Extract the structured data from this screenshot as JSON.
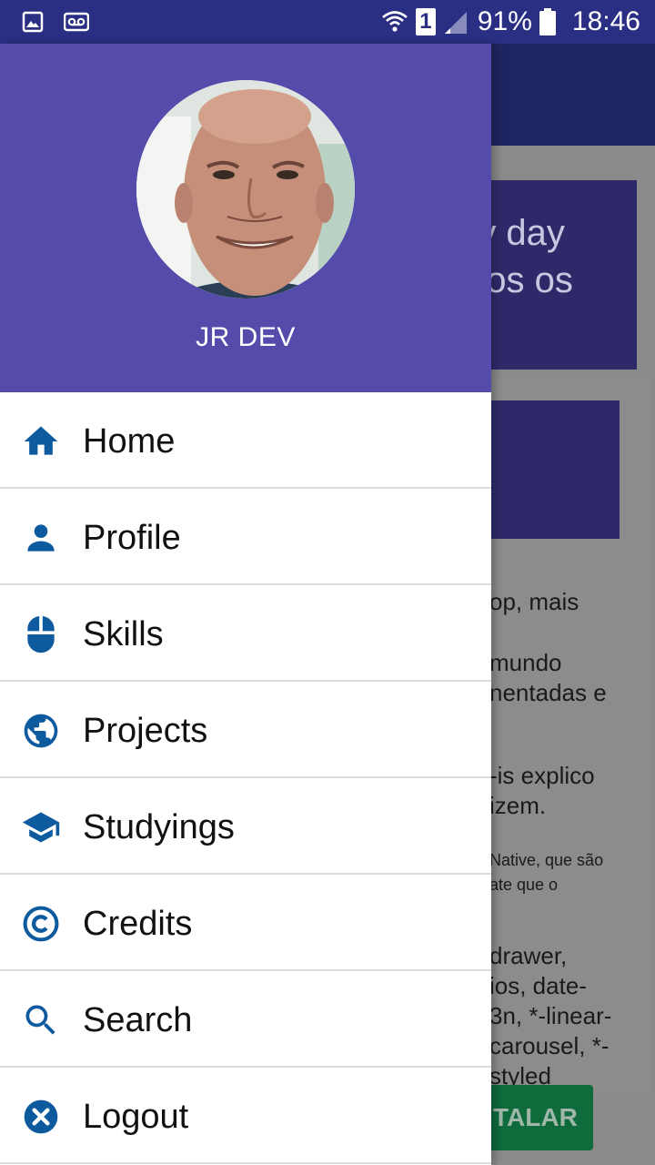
{
  "status_bar": {
    "icons_left": [
      "image-icon",
      "voicemail-icon"
    ],
    "icons_right": [
      "wifi-icon",
      "sim-icon",
      "signal-icon",
      "battery-icon"
    ],
    "sim_number": "1",
    "battery": "91%",
    "time": "18:46"
  },
  "drawer": {
    "user_name": "JR DEV",
    "items": [
      {
        "label": "Home",
        "icon": "home-icon"
      },
      {
        "label": "Profile",
        "icon": "person-icon"
      },
      {
        "label": "Skills",
        "icon": "mouse-icon"
      },
      {
        "label": "Projects",
        "icon": "globe-icon"
      },
      {
        "label": "Studyings",
        "icon": "graduation-cap-icon"
      },
      {
        "label": "Credits",
        "icon": "copyright-icon"
      },
      {
        "label": "Search",
        "icon": "search-icon"
      },
      {
        "label": "Logout",
        "icon": "close-circle-icon"
      }
    ]
  },
  "background": {
    "banner_line1": "ry day",
    "banner_line2": "dos os",
    "text1": "op, mais",
    "text2_line1": "mundo",
    "text2_line2": "nentadas e",
    "text3_line1": "-is explico",
    "text3_line2": "izem.",
    "text4_line1": "Native, que são",
    "text4_line2": "ate que o",
    "text5_line1": "drawer,",
    "text5_line2": "ios, date-",
    "text5_line3": "3n, *-linear-",
    "text5_line4": "carousel, *-",
    "text5_line5": "styled",
    "install_label": "TALAR"
  },
  "colors": {
    "status_bar": "#2b2f83",
    "drawer_header": "#544bab",
    "icon_color": "#0d5a9e",
    "app_bar": "#1f2560",
    "banner": "#2e2a6a",
    "install_button": "#0f6a3c"
  }
}
